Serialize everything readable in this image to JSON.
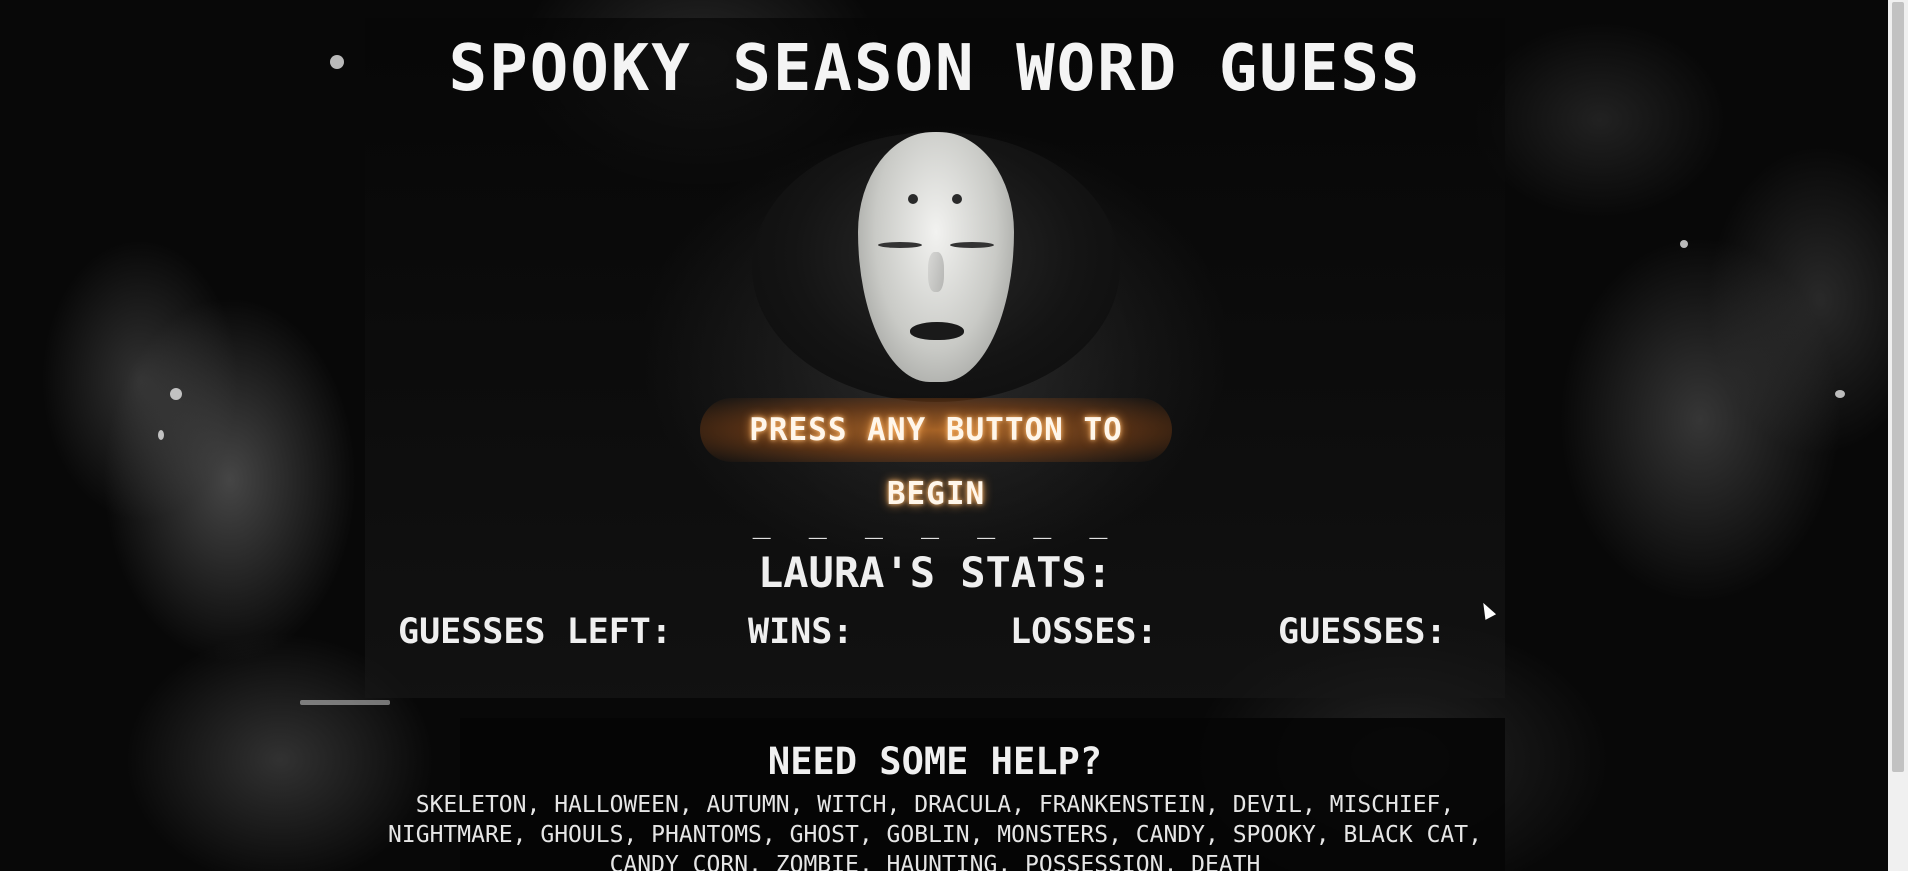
{
  "game": {
    "title": "SPOOKY SEASON WORD GUESS",
    "begin_prompt": "PRESS ANY BUTTON TO BEGIN",
    "word_blanks": "_ _ _ _ _ _ _"
  },
  "stats": {
    "heading": "LAURA'S STATS:",
    "guesses_left_label": "GUESSES LEFT:",
    "guesses_left_value": "",
    "wins_label": "WINS:",
    "wins_value": "",
    "losses_label": "LOSSES:",
    "losses_value": "",
    "guesses_label": "GUESSES:",
    "guesses_value": ""
  },
  "help": {
    "heading": "NEED SOME HELP?",
    "word_list": "SKELETON, HALLOWEEN, AUTUMN, WITCH, DRACULA, FRANKENSTEIN, DEVIL, MISCHIEF, NIGHTMARE, GHOULS, PHANTOMS, GHOST, GOBLIN, MONSTERS, CANDY, SPOOKY, BLACK CAT, CANDY CORN, ZOMBIE, HAUNTING, POSSESSION, DEATH"
  },
  "icons": {
    "mask_image": "white-mask-face",
    "cursor": "mouse-pointer-icon"
  },
  "colors": {
    "background": "#080808",
    "text": "#efefef",
    "begin_glow": "#d27828"
  }
}
